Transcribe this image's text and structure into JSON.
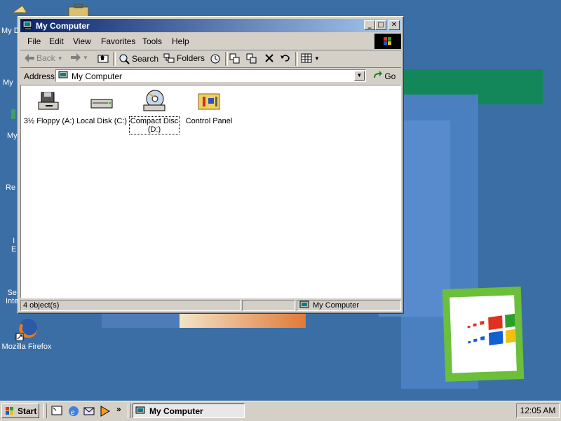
{
  "window": {
    "title": "My Computer",
    "buttons": {
      "minimize": "_",
      "maximize": "□",
      "close": "✕"
    }
  },
  "menubar": {
    "items": [
      "File",
      "Edit",
      "View",
      "Favorites",
      "Tools",
      "Help"
    ]
  },
  "toolbar": {
    "back": "Back",
    "search": "Search",
    "folders": "Folders"
  },
  "address": {
    "label": "Address",
    "value": "My Computer",
    "go": "Go"
  },
  "drives": [
    {
      "label": "3½ Floppy (A:)",
      "icon": "floppy-drive-icon"
    },
    {
      "label": "Local Disk (C:)",
      "icon": "hard-disk-icon"
    },
    {
      "label": "Compact Disc (D:)",
      "label_line1": "Compact Disc",
      "label_line2": "(D:)",
      "icon": "cd-drive-icon",
      "selected": true
    },
    {
      "label": "Control Panel",
      "icon": "control-panel-icon"
    }
  ],
  "status": {
    "count": "4 object(s)",
    "zone": "My Computer"
  },
  "desktop": {
    "icons": [
      {
        "label": "My D"
      },
      {
        "label": "My"
      },
      {
        "label": "My"
      },
      {
        "label": "Re"
      },
      {
        "label": "I"
      },
      {
        "label": "E"
      },
      {
        "label": "Se"
      },
      {
        "label": "Inte"
      },
      {
        "label": "Mozilla Firefox"
      }
    ]
  },
  "taskbar": {
    "start": "Start",
    "task": "My Computer",
    "clock": "12:05 AM",
    "chevron": "»"
  },
  "colors": {
    "desktop": "#3a6ea5",
    "titlebar_start": "#0a246a",
    "titlebar_end": "#a6caf0",
    "face": "#d4d0c8"
  }
}
